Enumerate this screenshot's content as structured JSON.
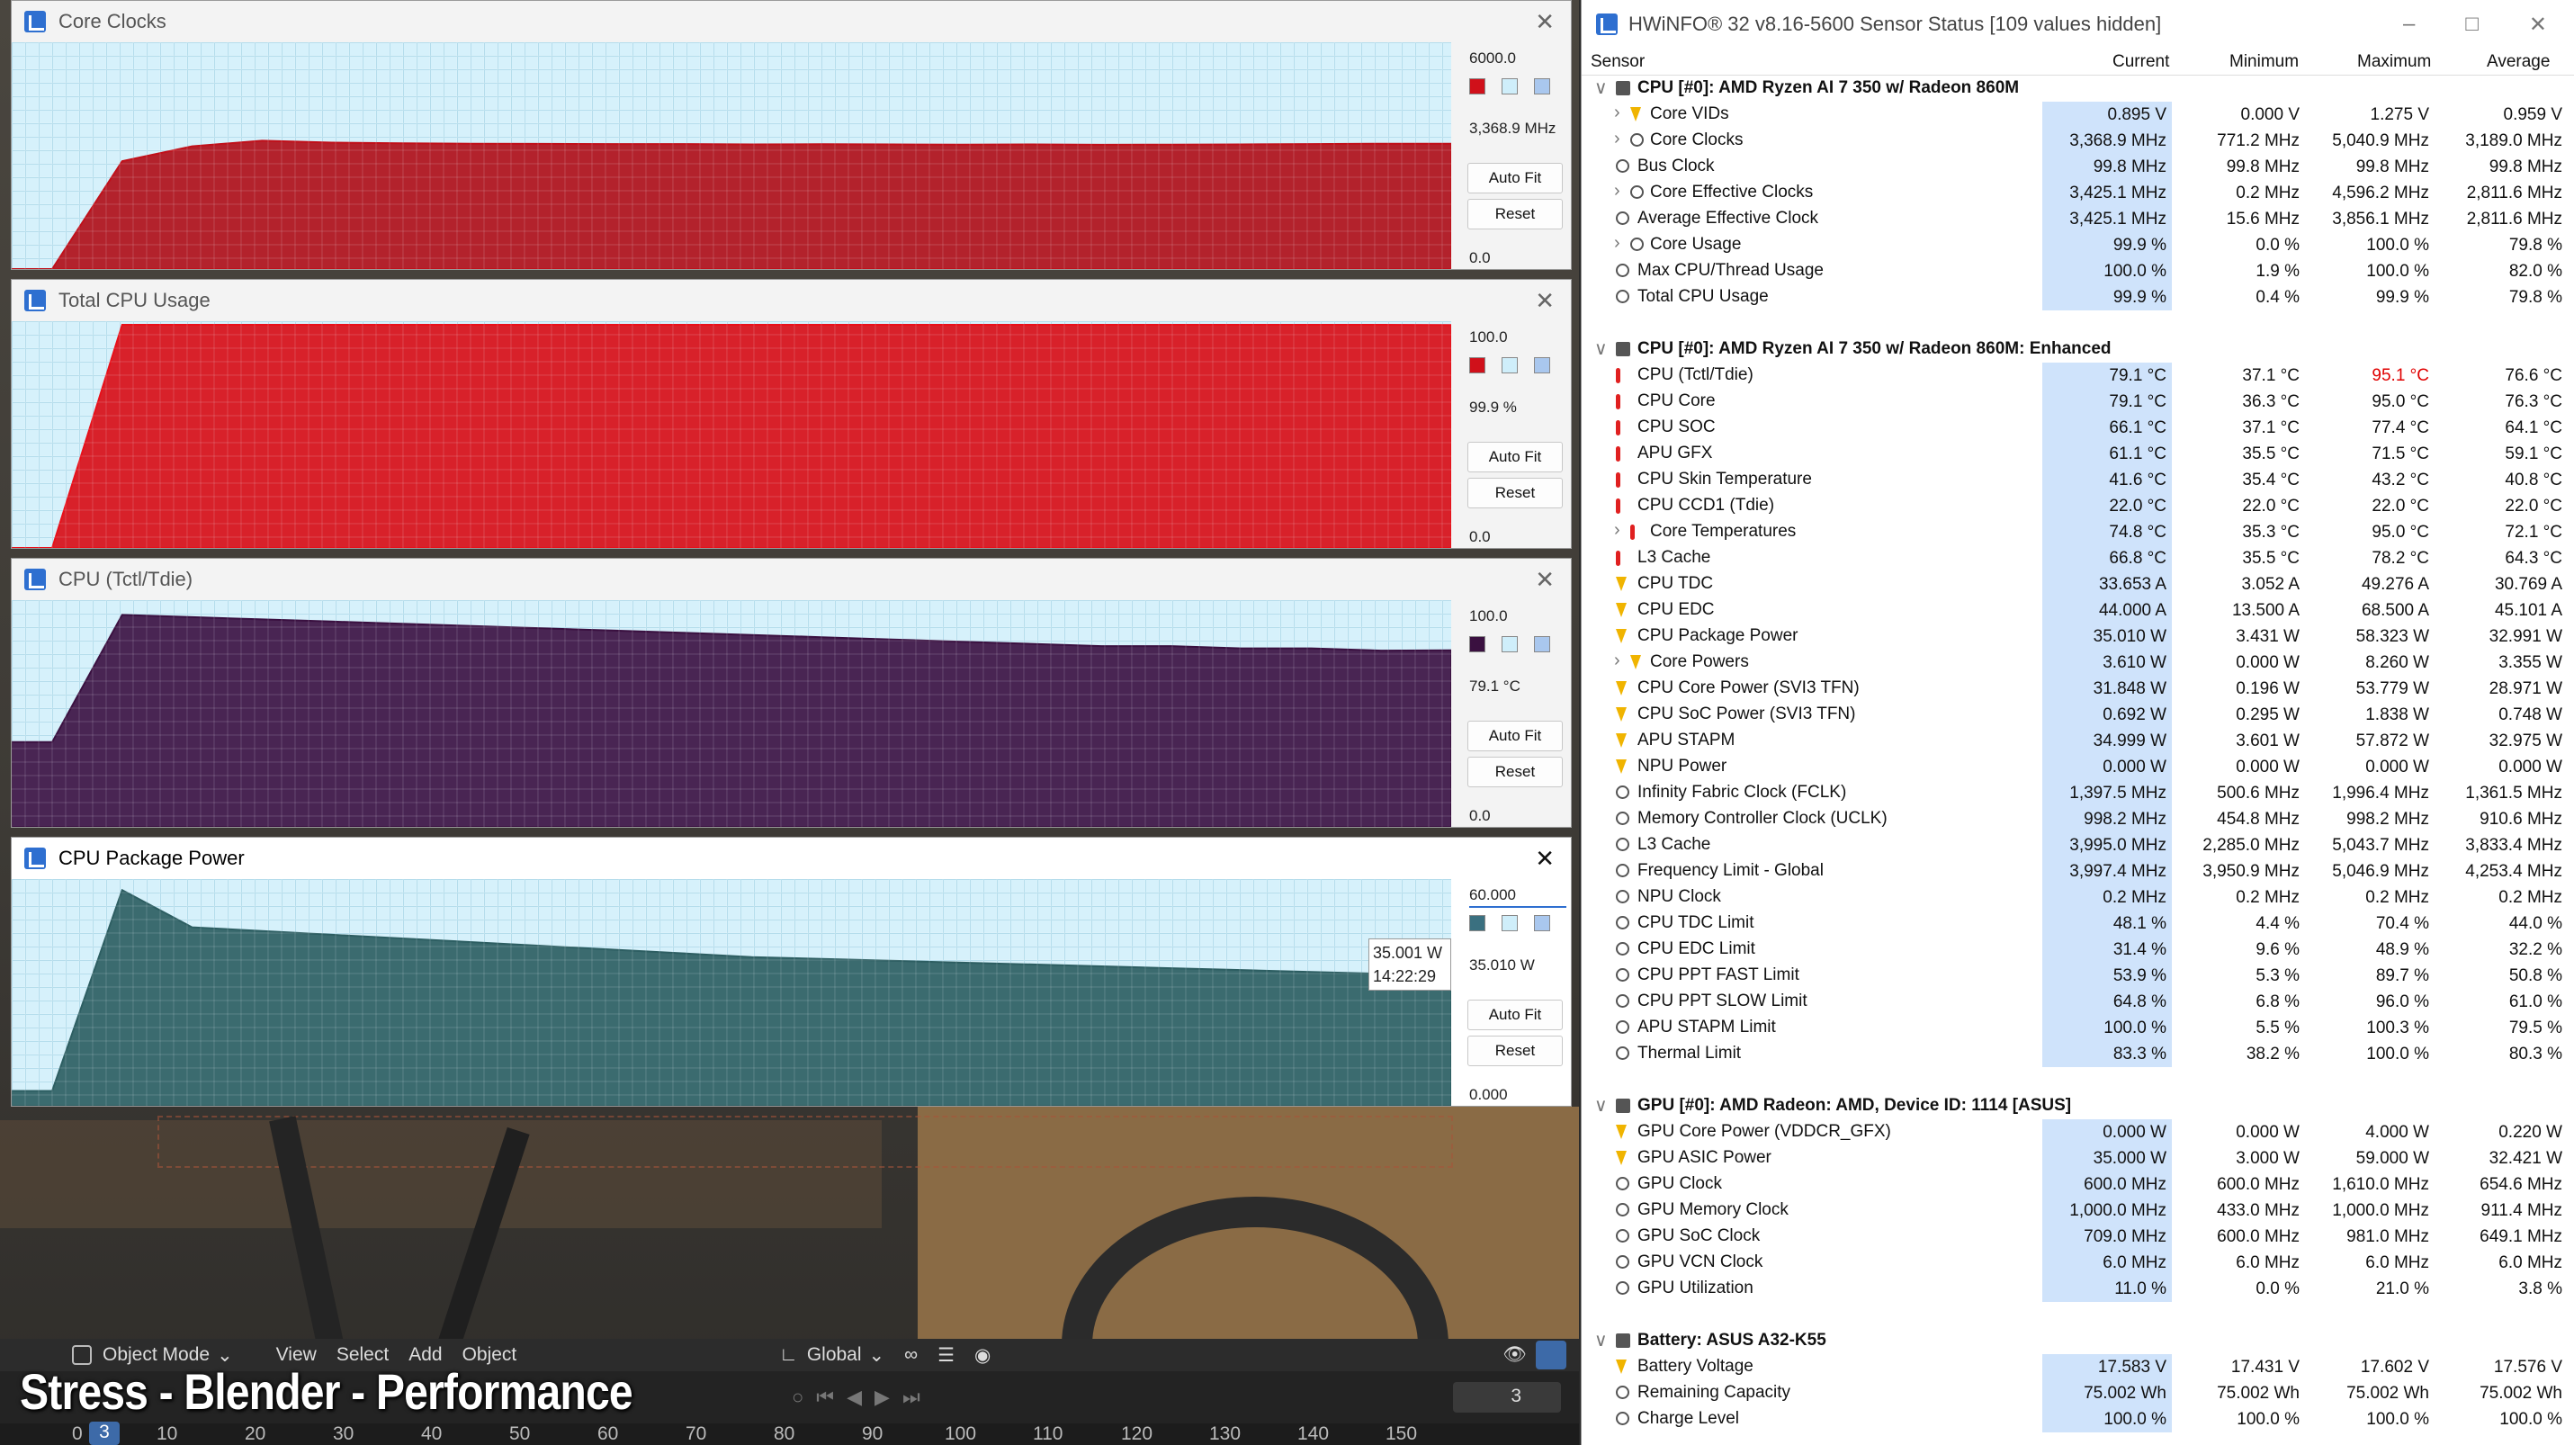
{
  "hwinfo": {
    "title": "HWiNFO® 32 v8.16-5600 Sensor Status [109 values hidden]",
    "window_controls": [
      "–",
      "□",
      "✕"
    ],
    "columns": [
      "Sensor",
      "Current",
      "Minimum",
      "Maximum",
      "Average"
    ],
    "rows": [
      {
        "type": "group",
        "name": "CPU [#0]: AMD Ryzen AI 7 350 w/ Radeon 860M"
      },
      {
        "name": "Core VIDs",
        "icon": "bolt",
        "expand": true,
        "cur": "0.895 V",
        "min": "0.000 V",
        "max": "1.275 V",
        "avg": "0.959 V"
      },
      {
        "name": "Core Clocks",
        "icon": "clock",
        "expand": true,
        "cur": "3,368.9 MHz",
        "min": "771.2 MHz",
        "max": "5,040.9 MHz",
        "avg": "3,189.0 MHz"
      },
      {
        "name": "Bus Clock",
        "icon": "clock",
        "cur": "99.8 MHz",
        "min": "99.8 MHz",
        "max": "99.8 MHz",
        "avg": "99.8 MHz"
      },
      {
        "name": "Core Effective Clocks",
        "icon": "clock",
        "expand": true,
        "cur": "3,425.1 MHz",
        "min": "0.2 MHz",
        "max": "4,596.2 MHz",
        "avg": "2,811.6 MHz"
      },
      {
        "name": "Average Effective Clock",
        "icon": "clock",
        "cur": "3,425.1 MHz",
        "min": "15.6 MHz",
        "max": "3,856.1 MHz",
        "avg": "2,811.6 MHz"
      },
      {
        "name": "Core Usage",
        "icon": "clock",
        "expand": true,
        "cur": "99.9 %",
        "min": "0.0 %",
        "max": "100.0 %",
        "avg": "79.8 %"
      },
      {
        "name": "Max CPU/Thread Usage",
        "icon": "clock",
        "cur": "100.0 %",
        "min": "1.9 %",
        "max": "100.0 %",
        "avg": "82.0 %"
      },
      {
        "name": "Total CPU Usage",
        "icon": "clock",
        "cur": "99.9 %",
        "min": "0.4 %",
        "max": "99.9 %",
        "avg": "79.8 %"
      },
      {
        "type": "gap"
      },
      {
        "type": "group",
        "name": "CPU [#0]: AMD Ryzen AI 7 350 w/ Radeon 860M: Enhanced"
      },
      {
        "name": "CPU (Tctl/Tdie)",
        "icon": "therm",
        "cur": "79.1 °C",
        "min": "37.1 °C",
        "max": "95.1 °C",
        "avg": "76.6 °C",
        "max_red": true
      },
      {
        "name": "CPU Core",
        "icon": "therm",
        "cur": "79.1 °C",
        "min": "36.3 °C",
        "max": "95.0 °C",
        "avg": "76.3 °C"
      },
      {
        "name": "CPU SOC",
        "icon": "therm",
        "cur": "66.1 °C",
        "min": "37.1 °C",
        "max": "77.4 °C",
        "avg": "64.1 °C"
      },
      {
        "name": "APU GFX",
        "icon": "therm",
        "cur": "61.1 °C",
        "min": "35.5 °C",
        "max": "71.5 °C",
        "avg": "59.1 °C"
      },
      {
        "name": "CPU Skin Temperature",
        "icon": "therm",
        "cur": "41.6 °C",
        "min": "35.4 °C",
        "max": "43.2 °C",
        "avg": "40.8 °C"
      },
      {
        "name": "CPU CCD1 (Tdie)",
        "icon": "therm",
        "cur": "22.0 °C",
        "min": "22.0 °C",
        "max": "22.0 °C",
        "avg": "22.0 °C"
      },
      {
        "name": "Core Temperatures",
        "icon": "therm",
        "expand": true,
        "cur": "74.8 °C",
        "min": "35.3 °C",
        "max": "95.0 °C",
        "avg": "72.1 °C"
      },
      {
        "name": "L3 Cache",
        "icon": "therm",
        "cur": "66.8 °C",
        "min": "35.5 °C",
        "max": "78.2 °C",
        "avg": "64.3 °C"
      },
      {
        "name": "CPU TDC",
        "icon": "bolt",
        "cur": "33.653 A",
        "min": "3.052 A",
        "max": "49.276 A",
        "avg": "30.769 A"
      },
      {
        "name": "CPU EDC",
        "icon": "bolt",
        "cur": "44.000 A",
        "min": "13.500 A",
        "max": "68.500 A",
        "avg": "45.101 A"
      },
      {
        "name": "CPU Package Power",
        "icon": "bolt",
        "cur": "35.010 W",
        "min": "3.431 W",
        "max": "58.323 W",
        "avg": "32.991 W"
      },
      {
        "name": "Core Powers",
        "icon": "bolt",
        "expand": true,
        "cur": "3.610 W",
        "min": "0.000 W",
        "max": "8.260 W",
        "avg": "3.355 W"
      },
      {
        "name": "CPU Core Power (SVI3 TFN)",
        "icon": "bolt",
        "cur": "31.848 W",
        "min": "0.196 W",
        "max": "53.779 W",
        "avg": "28.971 W"
      },
      {
        "name": "CPU SoC Power (SVI3 TFN)",
        "icon": "bolt",
        "cur": "0.692 W",
        "min": "0.295 W",
        "max": "1.838 W",
        "avg": "0.748 W"
      },
      {
        "name": "APU STAPM",
        "icon": "bolt",
        "cur": "34.999 W",
        "min": "3.601 W",
        "max": "57.872 W",
        "avg": "32.975 W"
      },
      {
        "name": "NPU Power",
        "icon": "bolt",
        "cur": "0.000 W",
        "min": "0.000 W",
        "max": "0.000 W",
        "avg": "0.000 W"
      },
      {
        "name": "Infinity Fabric Clock (FCLK)",
        "icon": "clock",
        "cur": "1,397.5 MHz",
        "min": "500.6 MHz",
        "max": "1,996.4 MHz",
        "avg": "1,361.5 MHz"
      },
      {
        "name": "Memory Controller Clock (UCLK)",
        "icon": "clock",
        "cur": "998.2 MHz",
        "min": "454.8 MHz",
        "max": "998.2 MHz",
        "avg": "910.6 MHz"
      },
      {
        "name": "L3 Cache",
        "icon": "clock",
        "cur": "3,995.0 MHz",
        "min": "2,285.0 MHz",
        "max": "5,043.7 MHz",
        "avg": "3,833.4 MHz"
      },
      {
        "name": "Frequency Limit - Global",
        "icon": "clock",
        "cur": "3,997.4 MHz",
        "min": "3,950.9 MHz",
        "max": "5,046.9 MHz",
        "avg": "4,253.4 MHz"
      },
      {
        "name": "NPU Clock",
        "icon": "clock",
        "cur": "0.2 MHz",
        "min": "0.2 MHz",
        "max": "0.2 MHz",
        "avg": "0.2 MHz"
      },
      {
        "name": "CPU TDC Limit",
        "icon": "clock",
        "cur": "48.1 %",
        "min": "4.4 %",
        "max": "70.4 %",
        "avg": "44.0 %"
      },
      {
        "name": "CPU EDC Limit",
        "icon": "clock",
        "cur": "31.4 %",
        "min": "9.6 %",
        "max": "48.9 %",
        "avg": "32.2 %"
      },
      {
        "name": "CPU PPT FAST Limit",
        "icon": "clock",
        "cur": "53.9 %",
        "min": "5.3 %",
        "max": "89.7 %",
        "avg": "50.8 %"
      },
      {
        "name": "CPU PPT SLOW Limit",
        "icon": "clock",
        "cur": "64.8 %",
        "min": "6.8 %",
        "max": "96.0 %",
        "avg": "61.0 %"
      },
      {
        "name": "APU STAPM Limit",
        "icon": "clock",
        "cur": "100.0 %",
        "min": "5.5 %",
        "max": "100.3 %",
        "avg": "79.5 %"
      },
      {
        "name": "Thermal Limit",
        "icon": "clock",
        "cur": "83.3 %",
        "min": "38.2 %",
        "max": "100.0 %",
        "avg": "80.3 %"
      },
      {
        "type": "gap"
      },
      {
        "type": "group",
        "name": "GPU [#0]: AMD Radeon: AMD, Device ID: 1114 [ASUS]"
      },
      {
        "name": "GPU Core Power (VDDCR_GFX)",
        "icon": "bolt",
        "cur": "0.000 W",
        "min": "0.000 W",
        "max": "4.000 W",
        "avg": "0.220 W"
      },
      {
        "name": "GPU ASIC Power",
        "icon": "bolt",
        "cur": "35.000 W",
        "min": "3.000 W",
        "max": "59.000 W",
        "avg": "32.421 W"
      },
      {
        "name": "GPU Clock",
        "icon": "clock",
        "cur": "600.0 MHz",
        "min": "600.0 MHz",
        "max": "1,610.0 MHz",
        "avg": "654.6 MHz"
      },
      {
        "name": "GPU Memory Clock",
        "icon": "clock",
        "cur": "1,000.0 MHz",
        "min": "433.0 MHz",
        "max": "1,000.0 MHz",
        "avg": "911.4 MHz"
      },
      {
        "name": "GPU SoC Clock",
        "icon": "clock",
        "cur": "709.0 MHz",
        "min": "600.0 MHz",
        "max": "981.0 MHz",
        "avg": "649.1 MHz"
      },
      {
        "name": "GPU VCN Clock",
        "icon": "clock",
        "cur": "6.0 MHz",
        "min": "6.0 MHz",
        "max": "6.0 MHz",
        "avg": "6.0 MHz"
      },
      {
        "name": "GPU Utilization",
        "icon": "clock",
        "cur": "11.0 %",
        "min": "0.0 %",
        "max": "21.0 %",
        "avg": "3.8 %"
      },
      {
        "type": "gap"
      },
      {
        "type": "group",
        "name": "Battery: ASUS  A32-K55"
      },
      {
        "name": "Battery Voltage",
        "icon": "bolt",
        "cur": "17.583 V",
        "min": "17.431 V",
        "max": "17.602 V",
        "avg": "17.576 V"
      },
      {
        "name": "Remaining Capacity",
        "icon": "clock",
        "cur": "75.002 Wh",
        "min": "75.002 Wh",
        "max": "75.002 Wh",
        "avg": "75.002 Wh"
      },
      {
        "name": "Charge Level",
        "icon": "clock",
        "cur": "100.0 %",
        "min": "100.0 %",
        "max": "100.0 %",
        "avg": "100.0 %"
      }
    ]
  },
  "graphs": [
    {
      "title": "Core Clocks",
      "max": "6000.0",
      "cur": "3,368.9 MHz",
      "min": "0.0",
      "color": "#c0101a",
      "fill": "#b0101a",
      "swatches": [
        "#d0101a",
        "#cfeefa",
        "#a9c7ee"
      ],
      "ymax": 6000,
      "series": [
        0,
        0,
        2900,
        3300,
        3450,
        3400,
        3380,
        3370,
        3365,
        3360,
        3360,
        3350,
        3355,
        3350,
        3345,
        3350,
        3340,
        3345,
        3350,
        3360,
        3370,
        3368.9
      ]
    },
    {
      "title": "Total CPU Usage",
      "max": "100.0",
      "cur": "99.9 %",
      "min": "0.0",
      "color": "#e8101a",
      "fill": "#d80f18",
      "swatches": [
        "#d0101a",
        "#cfeefa",
        "#a9c7ee"
      ],
      "ymax": 100,
      "series": [
        0,
        0,
        100,
        100,
        100,
        100,
        100,
        100,
        100,
        100,
        100,
        100,
        100,
        100,
        100,
        100,
        100,
        100,
        100,
        100,
        100,
        99.9
      ]
    },
    {
      "title": "CPU (Tctl/Tdie)",
      "max": "100.0",
      "cur": "79.1 °C",
      "min": "0.0",
      "color": "#3a1040",
      "fill": "#3d1344",
      "swatches": [
        "#3a1040",
        "#cfeefa",
        "#a9c7ee"
      ],
      "ymax": 100,
      "series": [
        38,
        38,
        95,
        94,
        93,
        92,
        91,
        90,
        89,
        88,
        87,
        86,
        85,
        84,
        83,
        82,
        81,
        81,
        80,
        80,
        79,
        79.1
      ]
    },
    {
      "title": "CPU Package Power",
      "max": "60.000",
      "cur": "35.010 W",
      "min": "0.000",
      "color": "#2d5e62",
      "fill": "#2e5f63",
      "swatches": [
        "#3a7080",
        "#cfeefa",
        "#a9c7ee"
      ],
      "ymax": 60,
      "series": [
        4,
        4,
        58,
        48,
        47,
        46,
        45,
        44,
        43,
        42,
        41,
        40,
        39.5,
        39,
        38.5,
        38,
        37.5,
        37,
        36.5,
        36,
        35.5,
        35.01
      ],
      "tooltip": [
        "35.001 W",
        "14:22:29"
      ]
    }
  ],
  "buttons": {
    "autofit": "Auto Fit",
    "reset": "Reset"
  },
  "blender": {
    "mode": "Object Mode",
    "menus": [
      "View",
      "Select",
      "Add",
      "Object"
    ],
    "transform": "Global",
    "frame": "3",
    "current_frame": "3",
    "ticks": [
      "0",
      "10",
      "20",
      "30",
      "40",
      "50",
      "60",
      "70",
      "80",
      "90",
      "100",
      "110",
      "120",
      "130",
      "140",
      "150"
    ]
  },
  "overlay_text": "Stress - Blender - Performance"
}
